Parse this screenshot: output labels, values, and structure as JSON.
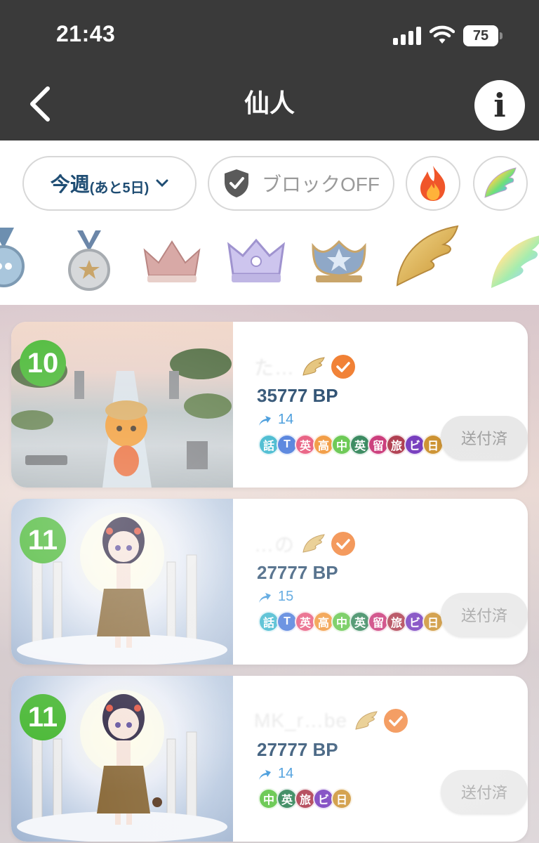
{
  "status_bar": {
    "time": "21:43",
    "battery": "75"
  },
  "nav": {
    "title": "仙人",
    "info_label": "i"
  },
  "filters": {
    "period_main": "今週",
    "period_sub": "(あと5日)",
    "block_label": "ブロックOFF"
  },
  "badges": [
    "medal-blue",
    "medal-silver",
    "crown-red",
    "crown-purple",
    "crown-blue",
    "wing-gold",
    "wing-rainbow"
  ],
  "entries": [
    {
      "rank": "10",
      "name": "た…",
      "bp": "35777 BP",
      "streak": "14",
      "tags": [
        "話",
        "T",
        "英",
        "高",
        "中",
        "英",
        "留",
        "旅",
        "ビ",
        "日"
      ],
      "button": "送付済"
    },
    {
      "rank": "11",
      "name": "…の",
      "bp": "27777 BP",
      "streak": "15",
      "tags": [
        "話",
        "T",
        "英",
        "高",
        "中",
        "英",
        "留",
        "旅",
        "ビ",
        "日"
      ],
      "button": "送付済"
    },
    {
      "rank": "11",
      "name": "MK_r…be",
      "bp": "27777 BP",
      "streak": "14",
      "tags": [
        "中",
        "英",
        "旅",
        "ビ",
        "日"
      ],
      "button": "送付済"
    }
  ],
  "colors": {
    "nav_bg": "#3a3a3a",
    "rank_green": "#44b62f",
    "bp_navy": "#1f4468",
    "verified_orange": "#f07b2c"
  }
}
